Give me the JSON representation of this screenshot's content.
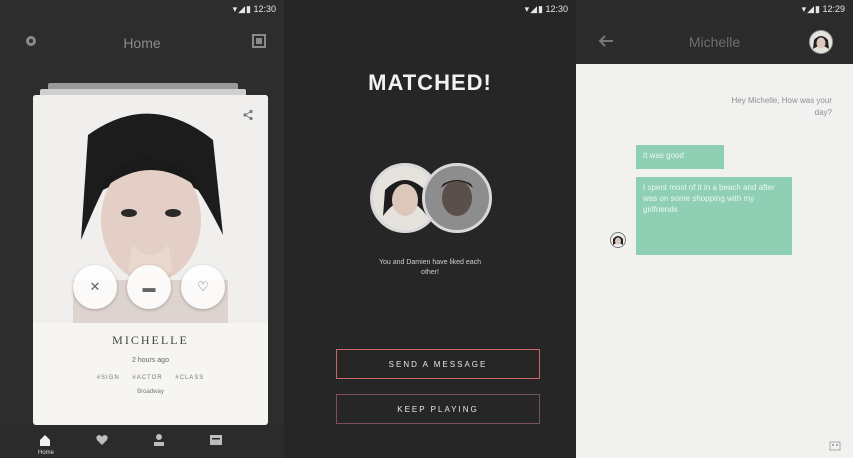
{
  "screen1": {
    "status_time": "12:30",
    "title": "Home",
    "profile": {
      "name": "MICHELLE",
      "last_seen": "2 hours ago",
      "tags": [
        "#SIGN",
        "#ACTOR",
        "#CLASS"
      ],
      "location": "Broadway"
    },
    "nav": {
      "home_label": "Home"
    }
  },
  "screen2": {
    "status_time": "12:30",
    "headline": "MATCHED!",
    "match_text": "You and Damien have liked each other!",
    "send_button": "SEND A MESSAGE",
    "keep_button": "KEEP PLAYING"
  },
  "screen3": {
    "status_time": "12:29",
    "title": "Michelle",
    "messages": [
      {
        "side": "right",
        "text": "Hey Michelle, How was your day?"
      },
      {
        "side": "left",
        "text": "It was good"
      },
      {
        "side": "left",
        "text": "I spent most of it in a beach and after was on some shopping with my girlfriends"
      }
    ]
  },
  "colors": {
    "accent_green": "#8fd0b5",
    "button_border": "#c86767",
    "dark_bg": "#262626"
  }
}
